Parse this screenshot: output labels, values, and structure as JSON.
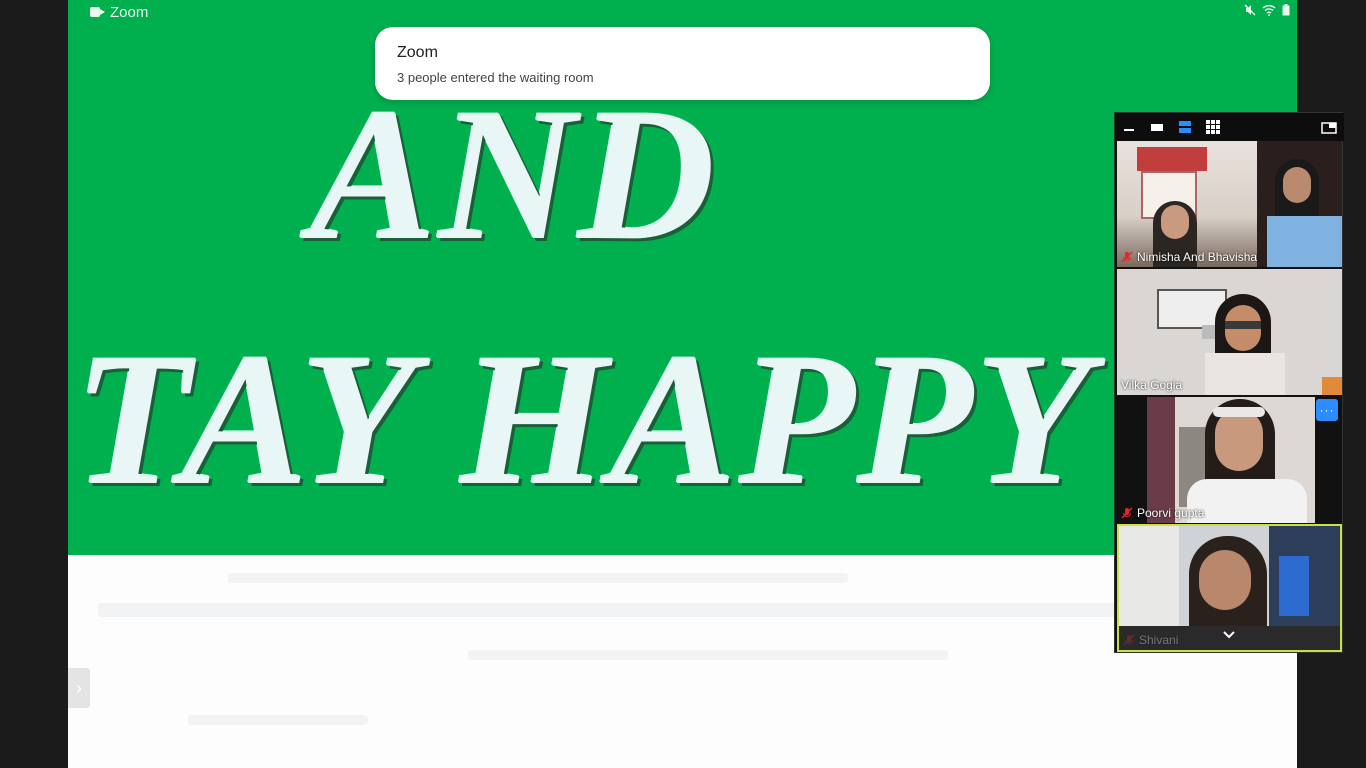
{
  "app": {
    "name": "Zoom"
  },
  "status_bar": {
    "app_label": "Zoom",
    "icons": [
      "video-camera-icon",
      "mute-icon",
      "wifi-icon",
      "battery-icon"
    ]
  },
  "notification": {
    "title": "Zoom",
    "message": "3 people entered the waiting room"
  },
  "shared_screen": {
    "slide_lines": [
      "AND",
      "TAY HAPPY"
    ],
    "background_color": "#00b04f"
  },
  "gallery": {
    "toolbar_icons": [
      "minimize-icon",
      "single-view-icon",
      "strip-view-icon",
      "grid-view-icon",
      "exit-fullscreen-icon"
    ],
    "participants": [
      {
        "name": "Nimisha And Bhavisha",
        "muted": true
      },
      {
        "name": "Vilka Gogia",
        "muted": false
      },
      {
        "name": "Poorvi gupta",
        "muted": true
      },
      {
        "name": "Shivani",
        "muted": true
      }
    ],
    "more_label": "···"
  },
  "colors": {
    "accent": "#2d8cff",
    "active_speaker": "#c8e04a",
    "mute": "#e02828"
  }
}
